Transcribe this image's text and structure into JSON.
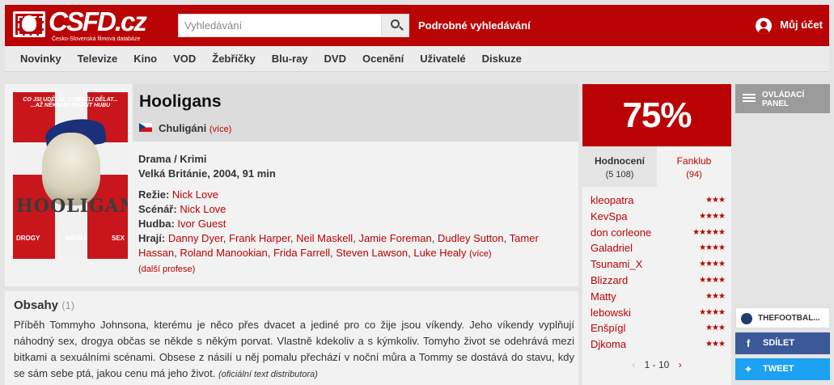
{
  "header": {
    "logo_text": "CSFD.cz",
    "logo_tagline": "Česko-Slovenská filmová databáze",
    "search_placeholder": "Vyhledávání",
    "advanced_search": "Podrobné vyhledávání",
    "account": "Můj účet"
  },
  "nav": [
    "Novinky",
    "Televize",
    "Kino",
    "VOD",
    "Žebříčky",
    "Blu-ray",
    "DVD",
    "Ocenění",
    "Uživatelé",
    "Diskuze"
  ],
  "film": {
    "title": "Hooligans",
    "alt_title": "Chuligáni",
    "alt_more": "(více)",
    "genre": "Drama / Krimi",
    "origin": "Velká Británie, 2004, 91 min",
    "director_label": "Režie:",
    "director": "Nick Love",
    "writer_label": "Scénář:",
    "writer": "Nick Love",
    "music_label": "Hudba:",
    "music": "Ivor Guest",
    "cast_label": "Hrají:",
    "cast": [
      "Danny Dyer",
      "Frank Harper",
      "Neil Maskell",
      "Jamie Foreman",
      "Dudley Sutton",
      "Tamer Hassan",
      "Roland Manookian",
      "Frida Farrell",
      "Steven Lawson",
      "Luke Healy"
    ],
    "cast_more": "(více)",
    "more_crew": "(další profese)",
    "poster": {
      "top_text": "CO JSI UDĚLAL V NEDĚLI DĚLAT... ...AŽ NĚKOMU ROZBÍT HUBU",
      "title": "HOOLIGANS",
      "sub_left": "DROGY",
      "sub_mid": "NÁSILÍ",
      "sub_right": "SEX"
    }
  },
  "plot": {
    "title": "Obsahy",
    "count": "(1)",
    "text": "Příběh Tommyho Johnsona, kterému je něco přes dvacet a jediné pro co žije jsou víkendy. Jeho víkendy vyplňují náhodný sex, drogya občas se někde s někým porvat. Vlastně kdekoliv a s kýmkoliv. Tomyho život se odehrává mezi bitkami a sexuálními scénami. Obsese z násilí u něj pomalu přechází v noční můra a Tommy se dostává do stavu, kdy se sám sebe ptá, jakou cenu má jeho život.",
    "source": "(oficiální text distributora)"
  },
  "rating": {
    "percent": "75%",
    "tab_ratings": "Hodnocení",
    "tab_ratings_count": "(5 108)",
    "tab_fanclub": "Fanklub",
    "tab_fanclub_count": "(94)",
    "users": [
      {
        "name": "kleopatra",
        "stars": 3
      },
      {
        "name": "KevSpa",
        "stars": 4
      },
      {
        "name": "don corleone",
        "stars": 5
      },
      {
        "name": "Galadriel",
        "stars": 4
      },
      {
        "name": "Tsunami_X",
        "stars": 4
      },
      {
        "name": "Blizzard",
        "stars": 4
      },
      {
        "name": "Matty",
        "stars": 3
      },
      {
        "name": "lebowski",
        "stars": 4
      },
      {
        "name": "Enšpígl",
        "stars": 3
      },
      {
        "name": "Djkoma",
        "stars": 3
      }
    ],
    "pager": "1 - 10"
  },
  "side": {
    "control_panel": "OVLÁDACÍ PANEL",
    "fanpage": "THEFOOTBAL...",
    "share": "SDÍLET",
    "tweet": "TWEET"
  },
  "colors": {
    "brand": "#ba0305",
    "facebook": "#3b5998",
    "twitter": "#1da1f2"
  }
}
